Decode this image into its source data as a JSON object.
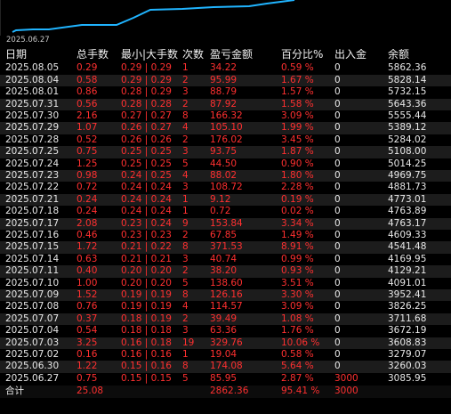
{
  "chart": {
    "date_label": "2025.06.27",
    "line_color": "#20b4ff"
  },
  "table": {
    "headers": {
      "date": "日期",
      "total_lots": "总手数",
      "min_max_lots": "最小|大手数",
      "count": "次数",
      "profit": "盈亏金额",
      "percent": "百分比%",
      "in_out": "出入金",
      "balance": "余额"
    },
    "rows": [
      {
        "date": "2025.08.05",
        "lots": "0.29",
        "minmax": "0.29 | 0.29",
        "count": "1",
        "profit": "34.22",
        "pct": "0.59 %",
        "flow": "0",
        "balance": "5862.36"
      },
      {
        "date": "2025.08.04",
        "lots": "0.58",
        "minmax": "0.29 | 0.29",
        "count": "2",
        "profit": "95.99",
        "pct": "1.67 %",
        "flow": "0",
        "balance": "5828.14"
      },
      {
        "date": "2025.08.01",
        "lots": "0.86",
        "minmax": "0.28 | 0.29",
        "count": "3",
        "profit": "88.79",
        "pct": "1.57 %",
        "flow": "0",
        "balance": "5732.15"
      },
      {
        "date": "2025.07.31",
        "lots": "0.56",
        "minmax": "0.28 | 0.28",
        "count": "2",
        "profit": "87.92",
        "pct": "1.58 %",
        "flow": "0",
        "balance": "5643.36"
      },
      {
        "date": "2025.07.30",
        "lots": "2.16",
        "minmax": "0.27 | 0.27",
        "count": "8",
        "profit": "166.32",
        "pct": "3.09 %",
        "flow": "0",
        "balance": "5555.44"
      },
      {
        "date": "2025.07.29",
        "lots": "1.07",
        "minmax": "0.26 | 0.27",
        "count": "4",
        "profit": "105.10",
        "pct": "1.99 %",
        "flow": "0",
        "balance": "5389.12"
      },
      {
        "date": "2025.07.28",
        "lots": "0.52",
        "minmax": "0.26 | 0.26",
        "count": "2",
        "profit": "176.02",
        "pct": "3.45 %",
        "flow": "0",
        "balance": "5284.02"
      },
      {
        "date": "2025.07.25",
        "lots": "0.75",
        "minmax": "0.25 | 0.25",
        "count": "3",
        "profit": "93.75",
        "pct": "1.87 %",
        "flow": "0",
        "balance": "5108.00"
      },
      {
        "date": "2025.07.24",
        "lots": "1.25",
        "minmax": "0.25 | 0.25",
        "count": "5",
        "profit": "44.50",
        "pct": "0.90 %",
        "flow": "0",
        "balance": "5014.25"
      },
      {
        "date": "2025.07.23",
        "lots": "0.98",
        "minmax": "0.24 | 0.25",
        "count": "4",
        "profit": "88.02",
        "pct": "1.80 %",
        "flow": "0",
        "balance": "4969.75"
      },
      {
        "date": "2025.07.22",
        "lots": "0.72",
        "minmax": "0.24 | 0.24",
        "count": "3",
        "profit": "108.72",
        "pct": "2.28 %",
        "flow": "0",
        "balance": "4881.73"
      },
      {
        "date": "2025.07.21",
        "lots": "0.24",
        "minmax": "0.24 | 0.24",
        "count": "1",
        "profit": "9.12",
        "pct": "0.19 %",
        "flow": "0",
        "balance": "4773.01"
      },
      {
        "date": "2025.07.18",
        "lots": "0.24",
        "minmax": "0.24 | 0.24",
        "count": "1",
        "profit": "0.72",
        "pct": "0.02 %",
        "flow": "0",
        "balance": "4763.89"
      },
      {
        "date": "2025.07.17",
        "lots": "2.08",
        "minmax": "0.23 | 0.24",
        "count": "9",
        "profit": "153.84",
        "pct": "3.34 %",
        "flow": "0",
        "balance": "4763.17"
      },
      {
        "date": "2025.07.16",
        "lots": "0.46",
        "minmax": "0.23 | 0.23",
        "count": "2",
        "profit": "67.85",
        "pct": "1.49 %",
        "flow": "0",
        "balance": "4609.33"
      },
      {
        "date": "2025.07.15",
        "lots": "1.72",
        "minmax": "0.21 | 0.22",
        "count": "8",
        "profit": "371.53",
        "pct": "8.91 %",
        "flow": "0",
        "balance": "4541.48"
      },
      {
        "date": "2025.07.14",
        "lots": "0.63",
        "minmax": "0.21 | 0.21",
        "count": "3",
        "profit": "40.74",
        "pct": "0.99 %",
        "flow": "0",
        "balance": "4169.95"
      },
      {
        "date": "2025.07.11",
        "lots": "0.40",
        "minmax": "0.20 | 0.20",
        "count": "2",
        "profit": "38.20",
        "pct": "0.93 %",
        "flow": "0",
        "balance": "4129.21"
      },
      {
        "date": "2025.07.10",
        "lots": "1.00",
        "minmax": "0.20 | 0.20",
        "count": "5",
        "profit": "138.60",
        "pct": "3.51 %",
        "flow": "0",
        "balance": "4091.01"
      },
      {
        "date": "2025.07.09",
        "lots": "1.52",
        "minmax": "0.19 | 0.19",
        "count": "8",
        "profit": "126.16",
        "pct": "3.30 %",
        "flow": "0",
        "balance": "3952.41"
      },
      {
        "date": "2025.07.08",
        "lots": "0.76",
        "minmax": "0.19 | 0.19",
        "count": "4",
        "profit": "114.57",
        "pct": "3.09 %",
        "flow": "0",
        "balance": "3826.25"
      },
      {
        "date": "2025.07.07",
        "lots": "0.37",
        "minmax": "0.18 | 0.19",
        "count": "2",
        "profit": "39.49",
        "pct": "1.08 %",
        "flow": "0",
        "balance": "3711.68"
      },
      {
        "date": "2025.07.04",
        "lots": "0.54",
        "minmax": "0.18 | 0.18",
        "count": "3",
        "profit": "63.36",
        "pct": "1.76 %",
        "flow": "0",
        "balance": "3672.19"
      },
      {
        "date": "2025.07.03",
        "lots": "3.25",
        "minmax": "0.16 | 0.18",
        "count": "19",
        "profit": "329.76",
        "pct": "10.06 %",
        "flow": "0",
        "balance": "3608.83"
      },
      {
        "date": "2025.07.02",
        "lots": "0.16",
        "minmax": "0.16 | 0.16",
        "count": "1",
        "profit": "19.04",
        "pct": "0.58 %",
        "flow": "0",
        "balance": "3279.07"
      },
      {
        "date": "2025.06.30",
        "lots": "1.22",
        "minmax": "0.15 | 0.16",
        "count": "8",
        "profit": "174.08",
        "pct": "5.64 %",
        "flow": "0",
        "balance": "3260.03"
      },
      {
        "date": "2025.06.27",
        "lots": "0.75",
        "minmax": "0.15 | 0.15",
        "count": "5",
        "profit": "85.95",
        "pct": "2.87 %",
        "flow": "3000",
        "balance": "3085.95"
      }
    ],
    "total": {
      "label": "合计",
      "lots": "25.08",
      "profit": "2862.36",
      "pct": "95.41 %",
      "flow": "3000"
    }
  }
}
